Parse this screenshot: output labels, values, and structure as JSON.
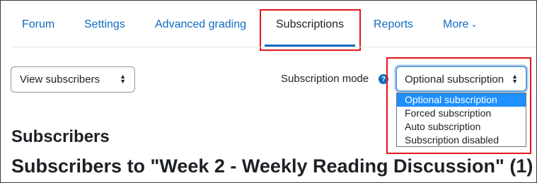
{
  "nav": {
    "tabs": [
      {
        "label": "Forum"
      },
      {
        "label": "Settings"
      },
      {
        "label": "Advanced grading"
      },
      {
        "label": "Subscriptions",
        "active": true
      },
      {
        "label": "Reports"
      },
      {
        "label": "More"
      }
    ]
  },
  "view_select": {
    "value": "View subscribers"
  },
  "subscription_mode": {
    "label": "Subscription mode",
    "help_glyph": "?",
    "selected": "Optional subscription",
    "options": [
      "Optional subscription",
      "Forced subscription",
      "Auto subscription",
      "Subscription disabled"
    ]
  },
  "headings": {
    "section": "Subscribers",
    "discussion": "Subscribers to \"Week 2 - Weekly Reading Discussion\" (1)"
  },
  "colors": {
    "link": "#0f6cbf",
    "highlight_box": "#e5141a",
    "option_selected_bg": "#1e90ff"
  }
}
